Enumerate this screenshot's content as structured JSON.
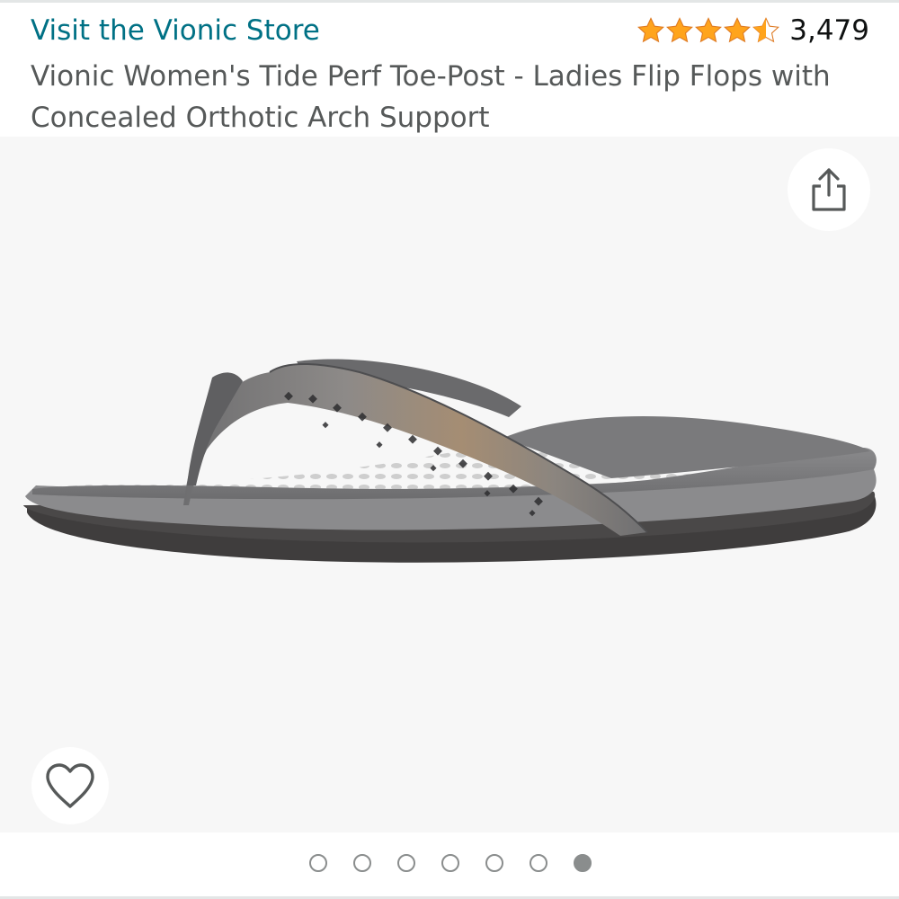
{
  "store": {
    "link_text": "Visit the Vionic Store"
  },
  "rating": {
    "stars": 4.5,
    "count": "3,479"
  },
  "product": {
    "title": "Vionic Women's Tide Perf Toe-Post - Ladies Flip Flops with Concealed Orthotic Arch Support",
    "image_icon": "flip-flop-sandal-image"
  },
  "actions": {
    "share_icon": "share-icon",
    "wishlist_icon": "heart-icon"
  },
  "carousel": {
    "count": 7,
    "active_index": 6
  },
  "colors": {
    "link": "#007185",
    "star": "#ffa41c",
    "text_secondary": "#565959",
    "image_bg": "#f7f7f7",
    "dot": "#8a8d8d"
  }
}
